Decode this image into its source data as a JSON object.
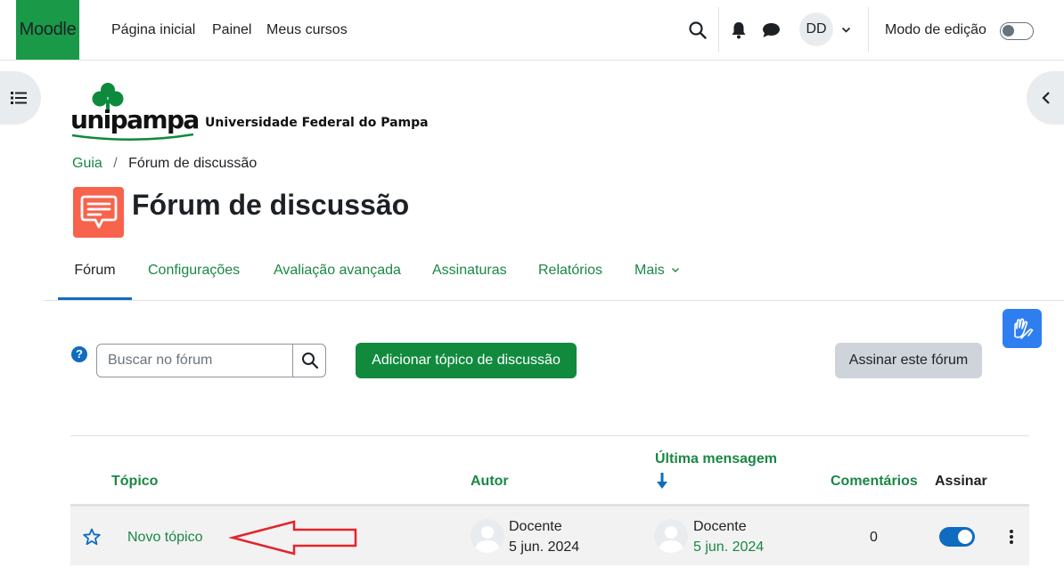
{
  "navbar": {
    "brand": "Moodle",
    "links": [
      "Página inicial",
      "Painel",
      "Meus cursos"
    ],
    "user_initials": "DD",
    "edit_mode_label": "Modo de edição"
  },
  "logo": {
    "wordmark": "unipampa",
    "university_name": "Universidade Federal do Pampa"
  },
  "breadcrumb": {
    "items": [
      "Guia",
      "Fórum de discussão"
    ],
    "separator": "/"
  },
  "page": {
    "title": "Fórum de discussão"
  },
  "tabs": [
    "Fórum",
    "Configurações",
    "Avaliação avançada",
    "Assinaturas",
    "Relatórios",
    "Mais"
  ],
  "controls": {
    "help_symbol": "?",
    "search_placeholder": "Buscar no fórum",
    "add_topic_label": "Adicionar tópico de discussão",
    "subscribe_label": "Assinar este fórum"
  },
  "table": {
    "headers": {
      "topic": "Tópico",
      "author": "Autor",
      "last_post": "Última mensagem",
      "comments": "Comentários",
      "subscribe": "Assinar"
    },
    "rows": [
      {
        "topic": "Novo tópico",
        "author_name": "Docente",
        "author_date": "5 jun. 2024",
        "last_name": "Docente",
        "last_date": "5 jun. 2024",
        "comments": "0",
        "subscribed": true
      }
    ]
  },
  "colors": {
    "brand_green": "#1a9a48",
    "link_green": "#1a8745",
    "button_green": "#118a3e",
    "toggle_blue": "#0f6cbf",
    "forum_icon": "#f7634d",
    "annotation_arrow": "#e3242b",
    "accessibility_blue": "#2f7ef0"
  },
  "icons": {
    "search": "search-icon",
    "notifications": "bell-icon",
    "messages": "chat-icon",
    "course_index": "list-icon",
    "block_drawer": "chevron-left-icon",
    "forum": "forum-icon",
    "accessibility": "sign-language-icon",
    "star": "star-icon",
    "actions": "kebab-menu-icon",
    "sort": "arrow-down-icon"
  }
}
